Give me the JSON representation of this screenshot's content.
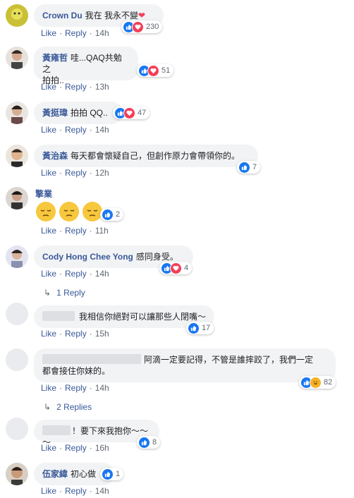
{
  "actions": {
    "like": "Like",
    "reply": "Reply"
  },
  "comments": [
    {
      "author": "Crown Du",
      "text": "我在 我永不變",
      "time": "14h",
      "count": "230"
    },
    {
      "author": "黃雍哲",
      "text": "哇...QAQ共勉之",
      "text2": "拍拍..",
      "time": "13h",
      "count": "51"
    },
    {
      "author": "黃挺瑋",
      "text": "拍拍 QQ..",
      "time": "14h",
      "count": "47"
    },
    {
      "author": "黃治森",
      "text": "每天都會懷疑自己，但創作原力會帶領你的。",
      "time": "12h",
      "count": "7"
    },
    {
      "author": "擎業",
      "time": "11h",
      "count": "2"
    },
    {
      "author": "Cody Hong Chee Yong",
      "text": "感同身受。",
      "time": "14h",
      "count": "4",
      "replies": "1 Reply"
    },
    {
      "text": "我相信你絕對可以讓那些人閉嘴～",
      "time": "15h",
      "count": "17"
    },
    {
      "text": "阿滴一定要記得，不管是誰摔跤了，我們一定",
      "text2": "都會接住你妹的。",
      "time": "14h",
      "count": "82",
      "replies": "2 Replies"
    },
    {
      "text": "！要下來我抱你～～～",
      "time": "16h",
      "count": "8"
    },
    {
      "author": "伍家緯",
      "text": "初心做",
      "time": "14h",
      "count": "1"
    }
  ]
}
